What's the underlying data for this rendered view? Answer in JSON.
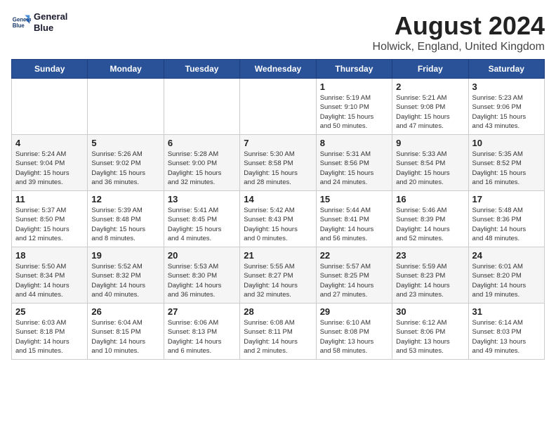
{
  "header": {
    "logo_line1": "General",
    "logo_line2": "Blue",
    "title": "August 2024",
    "subtitle": "Holwick, England, United Kingdom"
  },
  "days_of_week": [
    "Sunday",
    "Monday",
    "Tuesday",
    "Wednesday",
    "Thursday",
    "Friday",
    "Saturday"
  ],
  "weeks": [
    [
      {
        "day": "",
        "info": ""
      },
      {
        "day": "",
        "info": ""
      },
      {
        "day": "",
        "info": ""
      },
      {
        "day": "",
        "info": ""
      },
      {
        "day": "1",
        "info": "Sunrise: 5:19 AM\nSunset: 9:10 PM\nDaylight: 15 hours\nand 50 minutes."
      },
      {
        "day": "2",
        "info": "Sunrise: 5:21 AM\nSunset: 9:08 PM\nDaylight: 15 hours\nand 47 minutes."
      },
      {
        "day": "3",
        "info": "Sunrise: 5:23 AM\nSunset: 9:06 PM\nDaylight: 15 hours\nand 43 minutes."
      }
    ],
    [
      {
        "day": "4",
        "info": "Sunrise: 5:24 AM\nSunset: 9:04 PM\nDaylight: 15 hours\nand 39 minutes."
      },
      {
        "day": "5",
        "info": "Sunrise: 5:26 AM\nSunset: 9:02 PM\nDaylight: 15 hours\nand 36 minutes."
      },
      {
        "day": "6",
        "info": "Sunrise: 5:28 AM\nSunset: 9:00 PM\nDaylight: 15 hours\nand 32 minutes."
      },
      {
        "day": "7",
        "info": "Sunrise: 5:30 AM\nSunset: 8:58 PM\nDaylight: 15 hours\nand 28 minutes."
      },
      {
        "day": "8",
        "info": "Sunrise: 5:31 AM\nSunset: 8:56 PM\nDaylight: 15 hours\nand 24 minutes."
      },
      {
        "day": "9",
        "info": "Sunrise: 5:33 AM\nSunset: 8:54 PM\nDaylight: 15 hours\nand 20 minutes."
      },
      {
        "day": "10",
        "info": "Sunrise: 5:35 AM\nSunset: 8:52 PM\nDaylight: 15 hours\nand 16 minutes."
      }
    ],
    [
      {
        "day": "11",
        "info": "Sunrise: 5:37 AM\nSunset: 8:50 PM\nDaylight: 15 hours\nand 12 minutes."
      },
      {
        "day": "12",
        "info": "Sunrise: 5:39 AM\nSunset: 8:48 PM\nDaylight: 15 hours\nand 8 minutes."
      },
      {
        "day": "13",
        "info": "Sunrise: 5:41 AM\nSunset: 8:45 PM\nDaylight: 15 hours\nand 4 minutes."
      },
      {
        "day": "14",
        "info": "Sunrise: 5:42 AM\nSunset: 8:43 PM\nDaylight: 15 hours\nand 0 minutes."
      },
      {
        "day": "15",
        "info": "Sunrise: 5:44 AM\nSunset: 8:41 PM\nDaylight: 14 hours\nand 56 minutes."
      },
      {
        "day": "16",
        "info": "Sunrise: 5:46 AM\nSunset: 8:39 PM\nDaylight: 14 hours\nand 52 minutes."
      },
      {
        "day": "17",
        "info": "Sunrise: 5:48 AM\nSunset: 8:36 PM\nDaylight: 14 hours\nand 48 minutes."
      }
    ],
    [
      {
        "day": "18",
        "info": "Sunrise: 5:50 AM\nSunset: 8:34 PM\nDaylight: 14 hours\nand 44 minutes."
      },
      {
        "day": "19",
        "info": "Sunrise: 5:52 AM\nSunset: 8:32 PM\nDaylight: 14 hours\nand 40 minutes."
      },
      {
        "day": "20",
        "info": "Sunrise: 5:53 AM\nSunset: 8:30 PM\nDaylight: 14 hours\nand 36 minutes."
      },
      {
        "day": "21",
        "info": "Sunrise: 5:55 AM\nSunset: 8:27 PM\nDaylight: 14 hours\nand 32 minutes."
      },
      {
        "day": "22",
        "info": "Sunrise: 5:57 AM\nSunset: 8:25 PM\nDaylight: 14 hours\nand 27 minutes."
      },
      {
        "day": "23",
        "info": "Sunrise: 5:59 AM\nSunset: 8:23 PM\nDaylight: 14 hours\nand 23 minutes."
      },
      {
        "day": "24",
        "info": "Sunrise: 6:01 AM\nSunset: 8:20 PM\nDaylight: 14 hours\nand 19 minutes."
      }
    ],
    [
      {
        "day": "25",
        "info": "Sunrise: 6:03 AM\nSunset: 8:18 PM\nDaylight: 14 hours\nand 15 minutes."
      },
      {
        "day": "26",
        "info": "Sunrise: 6:04 AM\nSunset: 8:15 PM\nDaylight: 14 hours\nand 10 minutes."
      },
      {
        "day": "27",
        "info": "Sunrise: 6:06 AM\nSunset: 8:13 PM\nDaylight: 14 hours\nand 6 minutes."
      },
      {
        "day": "28",
        "info": "Sunrise: 6:08 AM\nSunset: 8:11 PM\nDaylight: 14 hours\nand 2 minutes."
      },
      {
        "day": "29",
        "info": "Sunrise: 6:10 AM\nSunset: 8:08 PM\nDaylight: 13 hours\nand 58 minutes."
      },
      {
        "day": "30",
        "info": "Sunrise: 6:12 AM\nSunset: 8:06 PM\nDaylight: 13 hours\nand 53 minutes."
      },
      {
        "day": "31",
        "info": "Sunrise: 6:14 AM\nSunset: 8:03 PM\nDaylight: 13 hours\nand 49 minutes."
      }
    ]
  ]
}
